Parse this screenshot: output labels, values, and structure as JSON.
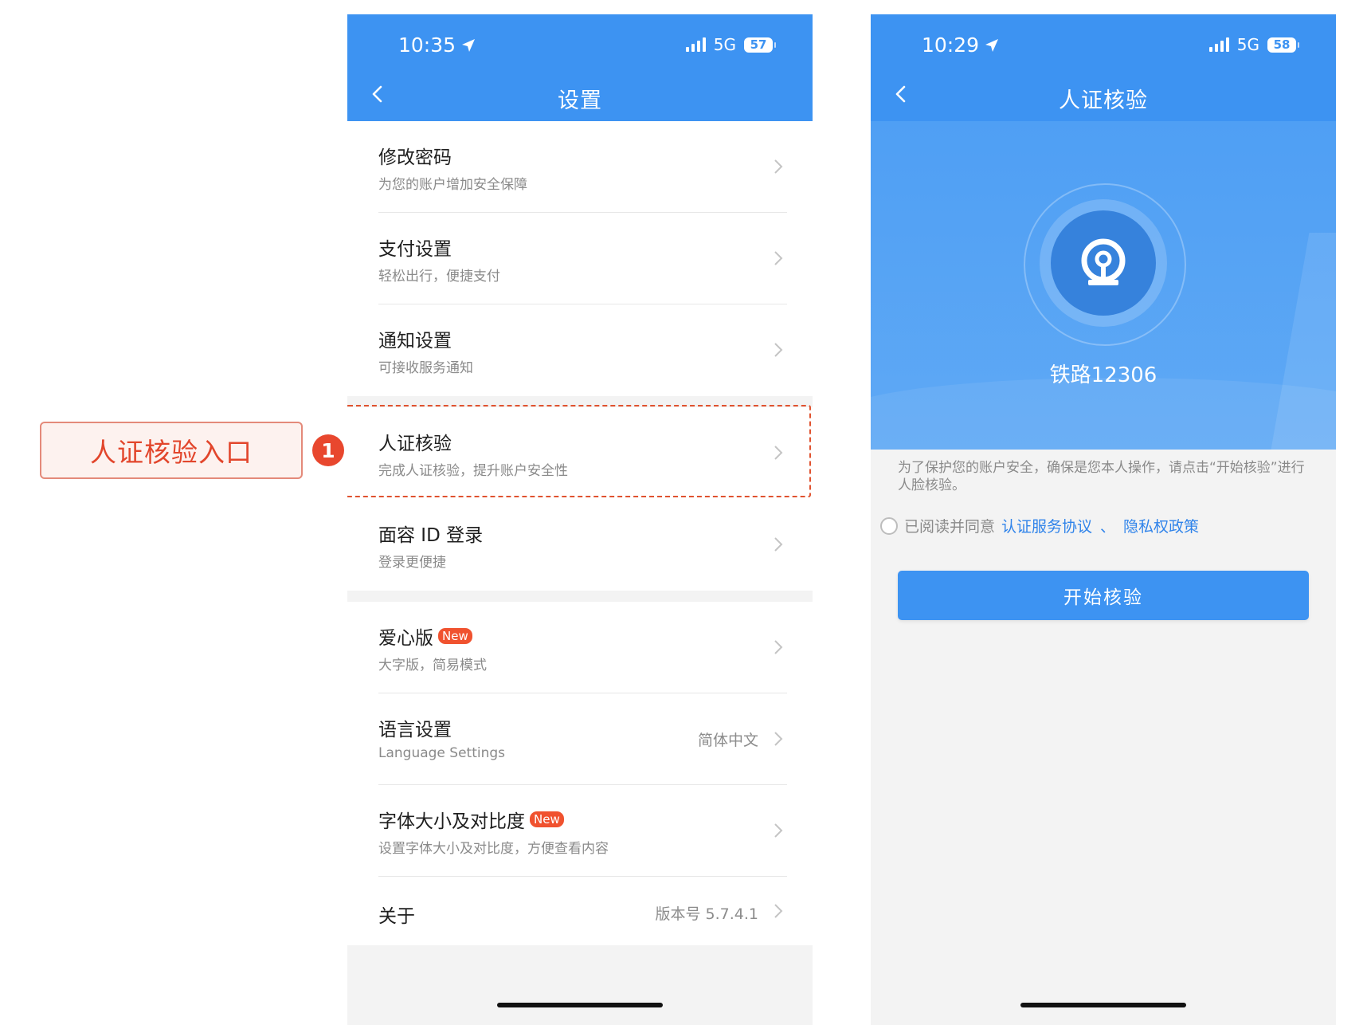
{
  "annotation": {
    "callout_label": "人证核验入口",
    "step_number": "1",
    "accent_color": "#e2462c"
  },
  "settings_screen": {
    "status_bar": {
      "time": "10:35",
      "network": "5G",
      "battery": "57"
    },
    "title": "设置",
    "items": [
      {
        "title": "修改密码",
        "subtitle": "为您的账户增加安全保障"
      },
      {
        "title": "支付设置",
        "subtitle": "轻松出行，便捷支付"
      },
      {
        "title": "通知设置",
        "subtitle": "可接收服务通知"
      },
      {
        "title": "人证核验",
        "subtitle": "完成人证核验，提升账户安全性"
      },
      {
        "title": "面容 ID 登录",
        "subtitle": "登录更便捷"
      },
      {
        "title": "爱心版",
        "badge": "New",
        "subtitle": "大字版，简易模式"
      },
      {
        "title": "语言设置",
        "subtitle": "Language Settings",
        "value": "简体中文"
      },
      {
        "title": "字体大小及对比度",
        "badge": "New",
        "subtitle": "设置字体大小及对比度，方便查看内容"
      },
      {
        "title": "关于",
        "value": "版本号 5.7.4.1"
      }
    ]
  },
  "verify_screen": {
    "status_bar": {
      "time": "10:29",
      "network": "5G",
      "battery": "58"
    },
    "title": "人证核验",
    "brand_name": "铁路12306",
    "notice": "为了保护您的账户安全，确保是您本人操作，请点击“开始核验”进行人脸核验。",
    "agree_prefix": "已阅读并同意",
    "link_terms": "认证服务协议",
    "separator": "、",
    "link_privacy": "隐私权政策",
    "start_button": "开始核验"
  },
  "colors": {
    "primary_blue": "#3d93f2",
    "badge_red": "#f0522f",
    "link_blue": "#2f83ea"
  }
}
